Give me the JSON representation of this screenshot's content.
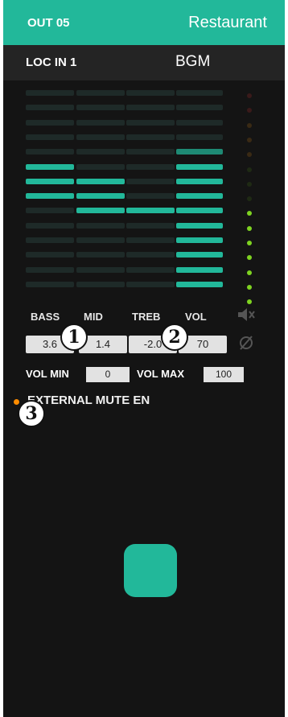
{
  "header": {
    "output": "OUT 05",
    "zone": "Restaurant"
  },
  "source": {
    "input": "LOC IN 1",
    "program": "BGM"
  },
  "channels": [
    {
      "label": "BASS",
      "value": "3.6",
      "level": 0.58
    },
    {
      "label": "MID",
      "value": "1.4",
      "level": 0.53
    },
    {
      "label": "TREB",
      "value": "-2.0",
      "level": 0.42
    },
    {
      "label": "VOL",
      "value": "70",
      "level": 0.68
    }
  ],
  "meter": {
    "active_fraction": 0.47
  },
  "vol_min": {
    "label": "VOL MIN",
    "value": "0"
  },
  "vol_max": {
    "label": "VOL MAX",
    "value": "100"
  },
  "external_mute": {
    "label": "EXTERNAL MUTE EN"
  },
  "badges": [
    "1",
    "2",
    "3"
  ],
  "icons": {
    "mute": "speaker-mute-icon",
    "phase": "phase-invert-icon"
  },
  "colors": {
    "accent": "#22b89a",
    "meter_green": "#7ed321",
    "mute_led": "#ff8c00"
  }
}
